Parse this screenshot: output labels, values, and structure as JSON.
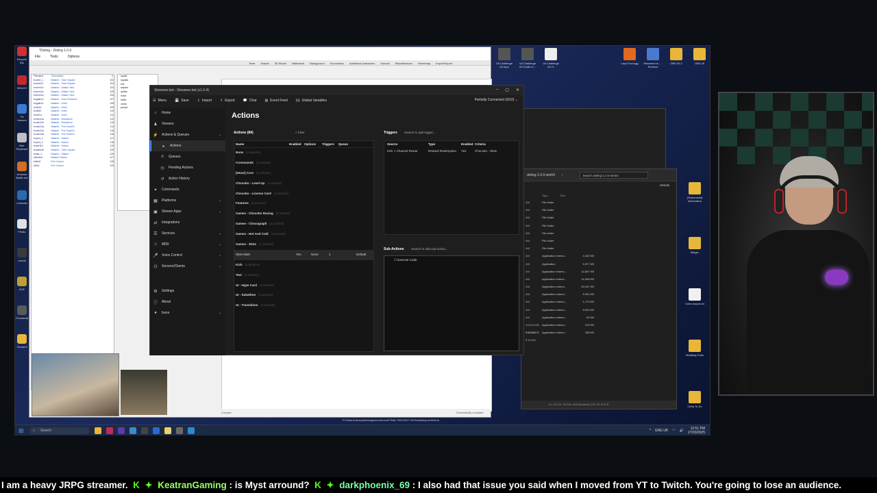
{
  "deling": {
    "title": "*Deling - Deling 1.0.0",
    "menu": [
      "File",
      "Tools",
      "Options"
    ],
    "tabs": [
      "Texts",
      "Scripts",
      "3D Model",
      "Walkmesh",
      "Background",
      "Encounters",
      "Additional characters",
      "Sounds",
      "Miscellaneous",
      "Worldmap",
      "Import/Export"
    ],
    "list_header": [
      "Filename",
      "Description",
      "#"
    ],
    "list_rows": [
      [
        "bccent_1",
        "Balamb - Town Square",
        "102"
      ],
      [
        "bccent12",
        "Balamb - Town Square",
        "103"
      ],
      [
        "bcform1a",
        "Balamb - Station Yard",
        "104"
      ],
      [
        "bcform1b",
        "Balamb - Station Yard",
        "105"
      ],
      [
        "bcform1a",
        "Balamb - Station Yard",
        "106"
      ],
      [
        "bcgate1a",
        "Balamb - Town Entrance",
        "107"
      ],
      [
        "bcgate1b",
        "Balamb - Hotel",
        "108"
      ],
      [
        "bchtl1a",
        "Balamb - Hotel",
        "109"
      ],
      [
        "bchtl1b",
        "Balamb - Hotel",
        "110"
      ],
      [
        "bchtr1a",
        "Balamb - Hotel",
        "111"
      ],
      [
        "bcmin11a",
        "Balamb - Residence",
        "112"
      ],
      [
        "bcmin11b",
        "Balamb - Residence",
        "113"
      ],
      [
        "bcmin21a",
        "Balamb - The Dincht's",
        "114"
      ],
      [
        "bcmin22a",
        "Balamb - The Dincht's",
        "115"
      ],
      [
        "bcmin23a",
        "Balamb - The Dincht's",
        "116"
      ],
      [
        "bcport_1",
        "Balamb - Harbor",
        "117"
      ],
      [
        "bcport_2",
        "Balamb - Harbor",
        "118"
      ],
      [
        "bcport1b",
        "Balamb - Harbor",
        "119"
      ],
      [
        "bcsaka1a",
        "Balamb - Town Square",
        "125"
      ],
      [
        "bcsta_1",
        "Balamb - Station",
        "126"
      ],
      [
        "bdenter1",
        "Balamb Harbor",
        "127"
      ],
      [
        "bdifnt1",
        "Fire Cavern",
        "128"
      ],
      [
        "bdin1",
        "Fire Cavern",
        "129"
      ]
    ],
    "entities": [
      "squall",
      "squalla",
      "zell",
      "selphie",
      "quistis",
      "irvine",
      "seifer",
      "check",
      "pamp1"
    ],
    "status_compile": "Compile",
    "status_ok": "Successfully compiled",
    "status_path": "D:/SteamLibrary/steamapps/common/FINAL FANTASY VIII/Data/lang-en/field.fs"
  },
  "streamerbot": {
    "title": "Streamer.bot - Streamer.bot (v1.0.4)",
    "menu": [
      "Menu",
      "Save",
      "Import",
      "Export",
      "Chat",
      "Event Feed",
      "Global Variables"
    ],
    "connection": "Partially Connected (9/10)",
    "sidebar": [
      {
        "label": "Home",
        "icon": "⌂"
      },
      {
        "label": "Viewers",
        "icon": "♟"
      },
      {
        "label": "Actions & Queues",
        "icon": "⚡"
      },
      {
        "label": "Actions",
        "icon": "▸",
        "sub": true,
        "active": true
      },
      {
        "label": "Queues",
        "icon": "≡",
        "sub": true
      },
      {
        "label": "Pending Actions",
        "icon": "◷",
        "sub": true
      },
      {
        "label": "Action History",
        "icon": "↺",
        "sub": true
      },
      {
        "label": "Commands",
        "icon": "✦"
      },
      {
        "label": "Platforms",
        "icon": "▦"
      },
      {
        "label": "Stream Apps",
        "icon": "▣"
      },
      {
        "label": "Integrations",
        "icon": "⇄"
      },
      {
        "label": "Services",
        "icon": "☰"
      },
      {
        "label": "MIDI",
        "icon": "♫"
      },
      {
        "label": "Voice Control",
        "icon": "🎤"
      },
      {
        "label": "Servers/Clients",
        "icon": "⌬"
      },
      {
        "label": "Settings",
        "icon": "⚙"
      },
      {
        "label": "About",
        "icon": "ⓘ"
      },
      {
        "label": "buna",
        "icon": "●"
      }
    ],
    "page_title": "Actions",
    "actions_panel": {
      "title": "Actions (84)",
      "filter": "Filter",
      "headers": [
        "Name",
        "Enabled",
        "Options",
        "Triggers",
        "Queue"
      ],
      "rows": [
        {
          "name": "None",
          "count": "(2 actions)"
        },
        {
          "name": "!Commands",
          "count": "(3 actions)"
        },
        {
          "name": "[Heart] Core",
          "count": "(2 actions)"
        },
        {
          "name": "Chocobo - Level Up",
          "count": "(2 actions)"
        },
        {
          "name": "Chocobo - License Card",
          "count": "(1 actions)"
        },
        {
          "name": "Features",
          "count": "(4 actions)"
        },
        {
          "name": "Games - Chocobo Racing",
          "count": "(3 actions)"
        },
        {
          "name": "Games - Chocograph",
          "count": "(2 actions)"
        },
        {
          "name": "Games - Hot And Cold",
          "count": "(3 actions)"
        },
        {
          "name": "Games - Slots",
          "count": "(1 actions)"
        },
        {
          "name": "Slots Main",
          "enabled": "Yes",
          "options": "None",
          "triggers": "1",
          "queue": "Default",
          "selected": true
        },
        {
          "name": "Kick",
          "count": "(2 actions)"
        },
        {
          "name": "Test",
          "count": "(1 actions)"
        },
        {
          "name": "UI - Hype Card",
          "count": "(3 actions)"
        },
        {
          "name": "UI - Subathon",
          "count": "(4 actions)"
        },
        {
          "name": "UI - Transitions",
          "count": "(2 actions)"
        }
      ]
    },
    "triggers_panel": {
      "title": "Triggers",
      "search": "Search to add trigger...",
      "headers": [
        "Source",
        "Type",
        "Enabled",
        "Criteria"
      ],
      "rows": [
        [
          "Kick > Channel Rewar",
          "Reward Redemption",
          "Yes",
          "Chocobo - Slots"
        ]
      ]
    },
    "subactions_panel": {
      "title": "Sub-Actions",
      "search": "Search to add sub-action...",
      "rows": [
        "Execute Code"
      ]
    }
  },
  "explorer": {
    "path": [
      "deling-1.0.0-win64"
    ],
    "search": "Search deling-1.0.0-win64",
    "details": "Details",
    "headers": [
      "Type",
      "Size"
    ],
    "rows": [
      [
        "AM",
        "File folder",
        ""
      ],
      [
        "AM",
        "File folder",
        ""
      ],
      [
        "AM",
        "File folder",
        ""
      ],
      [
        "AM",
        "File folder",
        ""
      ],
      [
        "AM",
        "File folder",
        ""
      ],
      [
        "AM",
        "File folder",
        ""
      ],
      [
        "AM",
        "File folder",
        ""
      ],
      [
        "AM",
        "Application extens...",
        "4,182 KB"
      ],
      [
        "AM",
        "Application",
        "5,577 KB"
      ],
      [
        "AM",
        "Application extens...",
        "12,807 KB"
      ],
      [
        "AM",
        "Application extens...",
        "14,408 KB"
      ],
      [
        "AM",
        "Application extens...",
        "20,157 KB"
      ],
      [
        "AM",
        "Application extens...",
        "5,933 KB"
      ],
      [
        "AM",
        "Application extens...",
        "1,713 KB"
      ],
      [
        "AM",
        "Application extens...",
        "5,924 KB"
      ],
      [
        "AM",
        "Application extens...",
        "63 KB"
      ],
      [
        "23/01/2025 9:15 AM",
        "Application extens...",
        "315 KB"
      ],
      [
        "23/01/2025 9:15 AM",
        "Application extens...",
        "158 KB"
      ]
    ],
    "status": "Ln: 24  Col: 44  Pos: 335    Windows (CR LF)    UTF-8"
  },
  "desktop": {
    "left_icons": [
      "Recycle Bin",
      "BEACH",
      "7th Heaven",
      "Nier Replicant",
      "Amazon Battle.net",
      "unmodel",
      "FINAL",
      "unreal",
      "KOF",
      "Thumbnail",
      "Tsunami"
    ],
    "top_icons": [
      "VA Challenge #3.mp4",
      "VA Challenge #3 Guide.m...",
      "Va Challenge #3.7z"
    ],
    "top_icons2": [
      "Lazy Fool.egg",
      "Streamer.bo... - Shortcut",
      "OBS 30.2",
      "OBS 28"
    ],
    "right_icons": [
      "[Tsunemodz] Information",
      "Midger",
      "Cetra Issues.txt",
      "Modding Tools",
      "Cetra To Do"
    ]
  },
  "taskbar": {
    "search": "Search",
    "lang": "ENG UK",
    "time": "12:51 PM",
    "date": "27/03/2025"
  },
  "chat_ticker": {
    "pre": "I am a heavy JRPG streamer.",
    "user1": "KeatranGaming",
    "msg1": ": is Myst arround?",
    "user2": "darkphoenix_69",
    "msg2": ": I also had that issue you said when I moved from YT to Twitch. You're going to lose an audience."
  },
  "colors": {
    "accent": "#4a90ff",
    "chat_user": "#9bff6a",
    "kick_green": "#53fc18"
  }
}
